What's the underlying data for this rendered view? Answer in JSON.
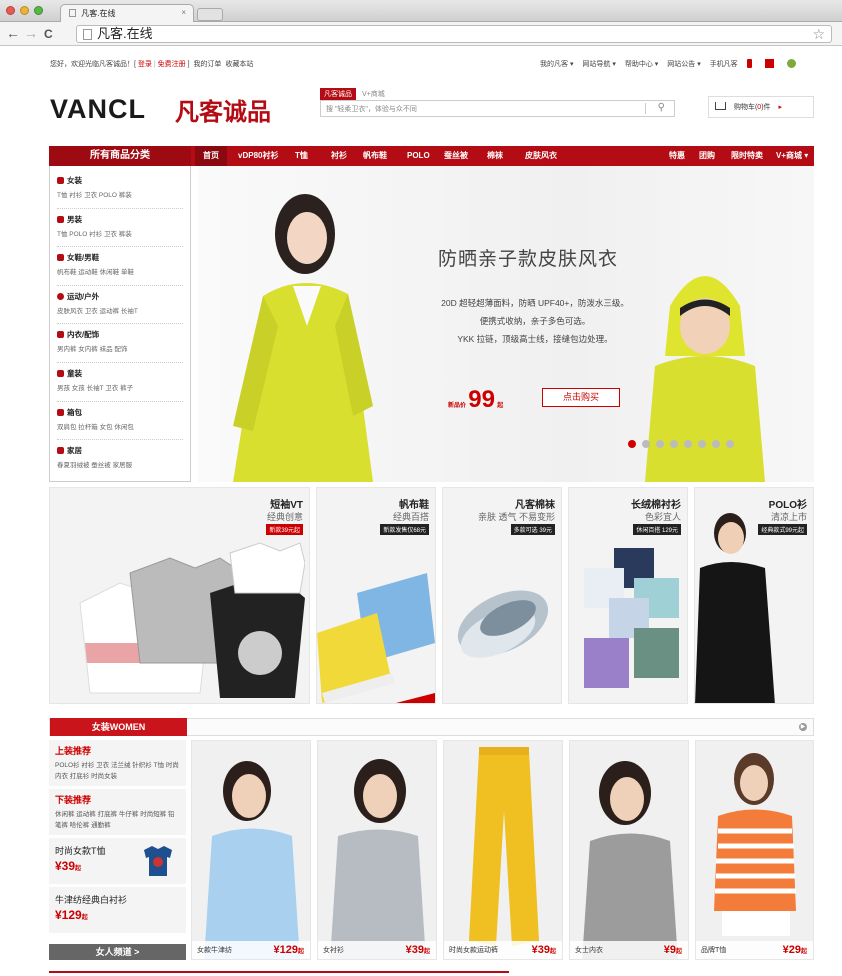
{
  "browser": {
    "tab_title": "凡客.在线",
    "tab_close": "×",
    "url": "凡客.在线",
    "back": "←",
    "forward": "→",
    "reload": "C",
    "star": "☆"
  },
  "topbar": {
    "welcome": "您好，欢迎光临凡客诚品！[",
    "login": "登录",
    "sep": "|",
    "register": "免费注册",
    "close": "]",
    "orders": "我的订单",
    "favorite": "收藏本站",
    "right_links": [
      "我的凡客 ▾",
      "网站导航 ▾",
      "帮助中心 ▾",
      "网站公告 ▾",
      "手机凡客"
    ]
  },
  "header": {
    "logo_en": "VANCL",
    "logo_cn": "凡客诚品",
    "search_tab_active": "凡客诚品",
    "search_tab_other": "V+商城",
    "search_placeholder": "搜 \"轻柔卫衣\"，体验与众不同",
    "search_icon": "search-icon",
    "cart_label": "购物车(",
    "cart_count": "0",
    "cart_suffix": ")件",
    "cart_arrow": "▸"
  },
  "nav": {
    "all_categories": "所有商品分类",
    "items": [
      "首页",
      "vDP80衬衫",
      "T恤",
      "衬衫",
      "帆布鞋",
      "POLO",
      "蚕丝被",
      "棉袜",
      "皮肤风衣"
    ],
    "right_items": [
      "特惠",
      "团购",
      "限时特卖",
      "V+商城 ▾"
    ]
  },
  "sidebar": [
    {
      "title": "女装",
      "subs": "T恤  衬衫  卫衣  POLO  裤装"
    },
    {
      "title": "男装",
      "subs": "T恤  POLO  衬衫  卫衣  裤装"
    },
    {
      "title": "女鞋/男鞋",
      "subs": "帆布鞋  运动鞋  休闲鞋  单鞋"
    },
    {
      "title": "运动/户外",
      "subs": "皮肤风衣  卫衣  运动裤  长袖T"
    },
    {
      "title": "内衣/配饰",
      "subs": "男内裤  女内裤  袜品  配饰"
    },
    {
      "title": "童装",
      "subs": "男孩  女孩  长袖T  卫衣  裤子"
    },
    {
      "title": "箱包",
      "subs": "双肩包  拉杆箱  女包  休闲包"
    },
    {
      "title": "家居",
      "subs": "春夏羽绒被  蚕丝被  家居服"
    }
  ],
  "banner": {
    "title": "防晒亲子款皮肤风衣",
    "lines": [
      "20D 超轻超薄面料，防晒 UPF40+，防泼水三级。",
      "便携式收纳，亲子多色可选。",
      "YKK 拉链，顶级高士线，接缝包边处理。"
    ],
    "price_prefix": "新品价",
    "price": "99",
    "price_suffix": "起",
    "buy_label": "点击购买",
    "slide_count": 8,
    "active_slide": 1
  },
  "tiles": [
    {
      "title": "短袖VT",
      "sub": "经典创意",
      "badge": "新款39元起"
    },
    {
      "title": "帆布鞋",
      "sub": "经典百搭",
      "badge": "新款发售仅68元"
    },
    {
      "title": "凡客棉袜",
      "sub": "亲肤 透气 不易变形",
      "badge": "多款可选  39元"
    },
    {
      "title": "长绒棉衬衫",
      "sub": "色彩宜人",
      "badge": "休闲百搭 129元"
    },
    {
      "title": "POLO衫",
      "sub": "清凉上市",
      "badge": "经典款式99元起"
    }
  ],
  "women": {
    "section_label": "女装WOMEN",
    "tops_title": "上装推荐",
    "tops": "POLO衫  衬衫  卫衣  法兰绒  针织衫  T恤  时尚内衣  打底衫  时尚女装",
    "bottoms_title": "下装推荐",
    "bottoms": "休闲裤  运动裤  打底裤  牛仔裤  时尚短裤  铅笔裤  哈伦裤  通勤裤",
    "promo1_name": "时尚女款T恤",
    "promo1_price": "¥39",
    "promo1_unit": "起",
    "promo2_name": "牛津纺经典白衬衫",
    "promo2_price": "¥129",
    "promo2_unit": "起",
    "channel": "女人频道 >",
    "products": [
      {
        "name": "女款牛津纺",
        "price": "¥129",
        "unit": "起"
      },
      {
        "name": "女衬衫",
        "price": "¥39",
        "unit": "起"
      },
      {
        "name": "时尚女款运动裤",
        "price": "¥39",
        "unit": "起"
      },
      {
        "name": "女士内衣",
        "price": "¥9",
        "unit": "起"
      },
      {
        "name": "品牌T恤",
        "price": "¥29",
        "unit": "起"
      }
    ]
  },
  "colors": {
    "brand_red": "#b40c14",
    "price_red": "#cc0000"
  }
}
